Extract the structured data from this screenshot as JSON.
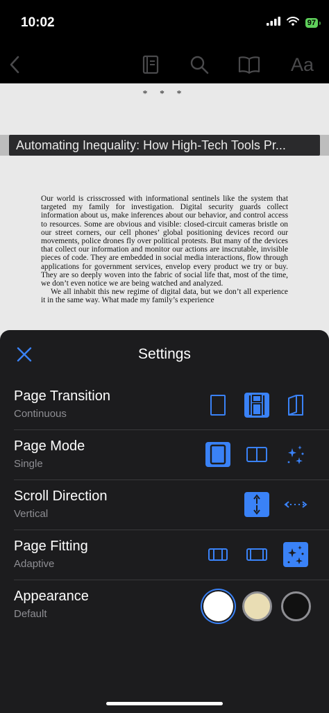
{
  "status": {
    "time": "10:02",
    "battery": "97"
  },
  "nav": {
    "aa_label": "Aa"
  },
  "reader": {
    "separator": "* * *",
    "chapter_title": "Automating Inequality: How High-Tech Tools Pr...",
    "paragraphs": [
      "Our world is crisscrossed with informational sentinels like the system that targeted my family for investigation. Digital security guards collect information about us, make inferences about our behavior, and control access to resources. Some are obvious and visible: closed-circuit cameras bristle on our street corners, our cell phones’ global positioning devices record our movements, police drones fly over political protests. But many of the devices that collect our information and monitor our actions are inscrutable, invisible pieces of code. They are embedded in social media interactions, flow through applications for government services, envelop every product we try or buy. They are so deeply woven into the fabric of social life that, most of the time, we don’t even notice we are being watched and analyzed.",
      "We all inhabit this new regime of digital data, but we don’t all experience it in the same way. What made my family’s experience"
    ]
  },
  "settings": {
    "title": "Settings",
    "rows": [
      {
        "label": "Page Transition",
        "value": "Continuous"
      },
      {
        "label": "Page Mode",
        "value": "Single"
      },
      {
        "label": "Scroll Direction",
        "value": "Vertical"
      },
      {
        "label": "Page Fitting",
        "value": "Adaptive"
      },
      {
        "label": "Appearance",
        "value": "Default"
      }
    ],
    "appearance_colors": {
      "white": "#ffffff",
      "sepia": "#e9ddb4",
      "black": "#111111"
    }
  },
  "colors": {
    "accent": "#3a82f7",
    "sheet_bg": "#1c1c1e",
    "page_bg": "#e9e9e9"
  }
}
